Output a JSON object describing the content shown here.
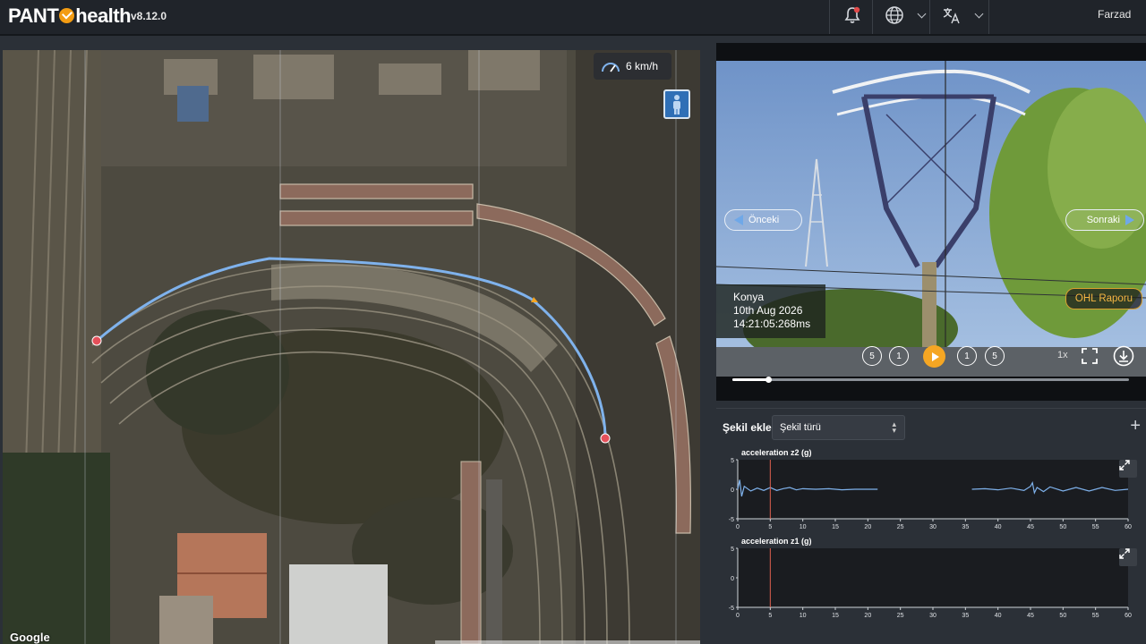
{
  "header": {
    "logo_text_left": "PANT",
    "logo_text_right": "health",
    "version": "v8.12.0",
    "user_name": "Farzad",
    "icons": [
      "bell-icon",
      "globe-icon",
      "translate-icon"
    ]
  },
  "map": {
    "speed": "6 km/h",
    "google_label": "Google",
    "route_color": "#7fb2ec",
    "marker_color": "#e4505a"
  },
  "video": {
    "prev_label": "Önceki",
    "next_label": "Sonraki",
    "location": "Konya",
    "date": "10th Aug 2026",
    "time": "14:21:05:268ms",
    "ohl_label": "OHL Raporu",
    "playback_rate": "1x",
    "progress": 0.09,
    "back_large_label": "5",
    "back_small_label": "1",
    "fwd_small_label": "1",
    "fwd_large_label": "5",
    "accent": "#f5a623"
  },
  "shape_panel": {
    "add_label": "Şekil ekle",
    "select_value": "Şekil türü",
    "plus": "+"
  },
  "charts": [
    {
      "title": "acceleration z2 (g)",
      "y_ticks": [
        "5",
        "0",
        "-5"
      ],
      "x_ticks": [
        "0",
        "5",
        "10",
        "15",
        "20",
        "25",
        "30",
        "35",
        "40",
        "45",
        "50",
        "55",
        "60"
      ],
      "marker_x": 5,
      "marker_color": "#e0604e",
      "line_color": "#7fb2ec"
    },
    {
      "title": "acceleration z1 (g)",
      "y_ticks": [
        "5",
        "0",
        "-5"
      ],
      "x_ticks": [
        "0",
        "5",
        "10",
        "15",
        "20",
        "25",
        "30",
        "35",
        "40",
        "45",
        "50",
        "55",
        "60"
      ],
      "marker_x": 5,
      "marker_color": "#e0604e"
    }
  ],
  "chart_data": [
    {
      "type": "line",
      "title": "acceleration z2 (g)",
      "xlim": [
        0,
        60
      ],
      "ylim": [
        -5,
        5
      ],
      "series": [
        {
          "x": [
            0,
            0.3,
            0.6,
            1,
            2,
            3,
            4,
            5,
            6,
            7,
            8,
            9,
            10,
            12,
            14,
            16,
            18,
            20,
            21.5,
            36,
            38,
            40,
            42,
            44,
            45,
            45.3,
            45.6,
            46,
            47,
            48,
            50,
            52,
            54,
            56,
            58,
            60
          ],
          "y": [
            0,
            1.6,
            -1.2,
            0.5,
            -0.3,
            0.2,
            -0.2,
            0.3,
            -0.2,
            0.1,
            0.3,
            -0.1,
            0.1,
            0,
            0.1,
            -0.1,
            0,
            0,
            0,
            0,
            0.1,
            -0.1,
            0.2,
            -0.2,
            0.5,
            1.1,
            -0.6,
            0.3,
            -0.4,
            0.4,
            -0.3,
            0.3,
            -0.3,
            0.3,
            -0.2,
            0
          ]
        }
      ]
    },
    {
      "type": "line",
      "title": "acceleration z1 (g)",
      "xlim": [
        0,
        60
      ],
      "ylim": [
        -5,
        5
      ],
      "series": []
    }
  ]
}
